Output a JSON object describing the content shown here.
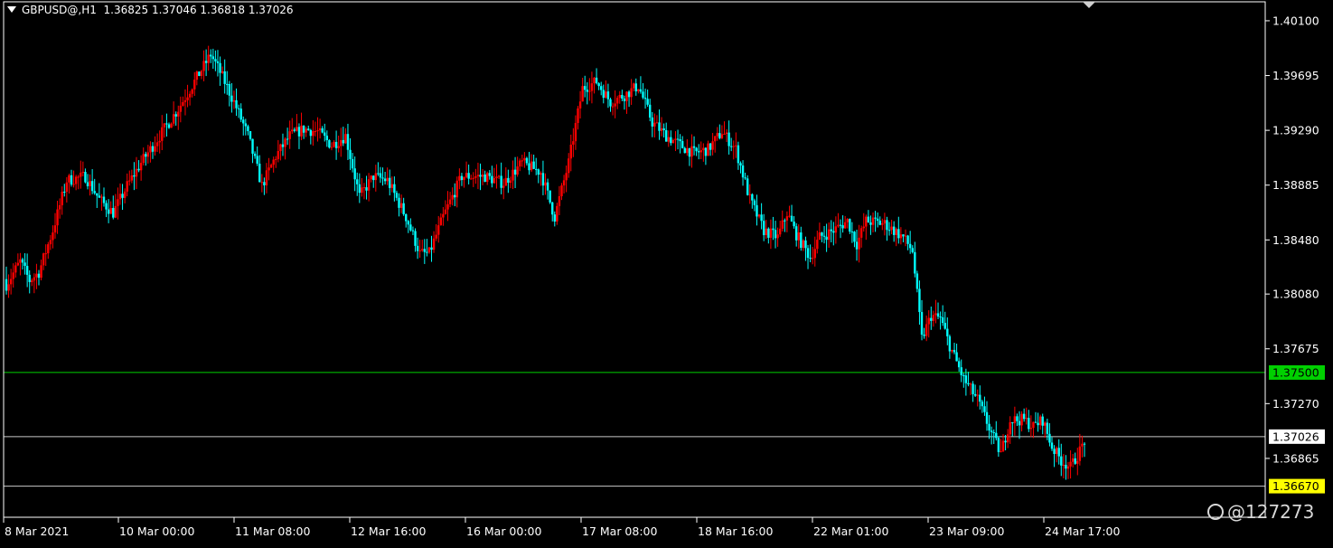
{
  "header": {
    "symbol": "GBPUSD@,H1",
    "ohlc": "1.36825 1.37046 1.36818 1.37026"
  },
  "watermark": {
    "text": "@127273"
  },
  "chart_data": {
    "type": "candlestick",
    "symbol": "GBPUSD@",
    "timeframe": "H1",
    "ylim": [
      1.3643,
      1.4024
    ],
    "colors": {
      "bull": "#ff0000",
      "bear": "#00ffff",
      "background": "#000000",
      "axis": "#ffffff"
    },
    "y_ticks": [
      "1.40100",
      "1.39695",
      "1.39290",
      "1.38885",
      "1.38480",
      "1.38080",
      "1.37675",
      "1.37270",
      "1.36865"
    ],
    "x_ticks": [
      "8 Mar 2021",
      "10 Mar 00:00",
      "11 Mar 08:00",
      "12 Mar 16:00",
      "16 Mar 00:00",
      "17 Mar 08:00",
      "18 Mar 16:00",
      "22 Mar 01:00",
      "23 Mar 09:00",
      "24 Mar 17:00"
    ],
    "horizontal_lines": [
      {
        "price": 1.375,
        "label": "1.37500",
        "color": "#00d000",
        "label_bg": "#00d000",
        "label_color": "#000000"
      },
      {
        "price": 1.37026,
        "label": "1.37026",
        "color": "#c8c8c8",
        "label_bg": "#ffffff",
        "label_color": "#000000"
      },
      {
        "price": 1.3666,
        "label": "1.36670",
        "color": "#c8c8c8",
        "label_bg": "#ffff00",
        "label_color": "#000000"
      }
    ],
    "key_points": [
      [
        0,
        1.3815
      ],
      [
        6,
        1.3832
      ],
      [
        10,
        1.3818
      ],
      [
        14,
        1.3824
      ],
      [
        20,
        1.3855
      ],
      [
        26,
        1.3892
      ],
      [
        34,
        1.3895
      ],
      [
        40,
        1.3878
      ],
      [
        46,
        1.3868
      ],
      [
        52,
        1.3888
      ],
      [
        58,
        1.3905
      ],
      [
        66,
        1.3925
      ],
      [
        74,
        1.3945
      ],
      [
        82,
        1.3968
      ],
      [
        88,
        1.3985
      ],
      [
        92,
        1.3972
      ],
      [
        98,
        1.395
      ],
      [
        104,
        1.3925
      ],
      [
        110,
        1.3888
      ],
      [
        116,
        1.391
      ],
      [
        122,
        1.3925
      ],
      [
        128,
        1.393
      ],
      [
        134,
        1.3928
      ],
      [
        140,
        1.3918
      ],
      [
        146,
        1.3925
      ],
      [
        152,
        1.388
      ],
      [
        158,
        1.3895
      ],
      [
        164,
        1.3892
      ],
      [
        172,
        1.3865
      ],
      [
        178,
        1.3838
      ],
      [
        182,
        1.3838
      ],
      [
        188,
        1.3865
      ],
      [
        196,
        1.3895
      ],
      [
        206,
        1.3895
      ],
      [
        214,
        1.389
      ],
      [
        222,
        1.3905
      ],
      [
        230,
        1.3898
      ],
      [
        236,
        1.3865
      ],
      [
        242,
        1.3905
      ],
      [
        248,
        1.396
      ],
      [
        254,
        1.3965
      ],
      [
        260,
        1.395
      ],
      [
        266,
        1.3955
      ],
      [
        272,
        1.3962
      ],
      [
        278,
        1.3935
      ],
      [
        284,
        1.3925
      ],
      [
        290,
        1.3918
      ],
      [
        296,
        1.3912
      ],
      [
        302,
        1.3915
      ],
      [
        308,
        1.3928
      ],
      [
        314,
        1.3915
      ],
      [
        320,
        1.3878
      ],
      [
        326,
        1.3855
      ],
      [
        332,
        1.385
      ],
      [
        336,
        1.3868
      ],
      [
        340,
        1.3852
      ],
      [
        346,
        1.3835
      ],
      [
        350,
        1.385
      ],
      [
        356,
        1.3855
      ],
      [
        362,
        1.3862
      ],
      [
        366,
        1.3845
      ],
      [
        370,
        1.3862
      ],
      [
        378,
        1.386
      ],
      [
        386,
        1.385
      ],
      [
        390,
        1.384
      ],
      [
        394,
        1.3775
      ],
      [
        398,
        1.3792
      ],
      [
        402,
        1.379
      ],
      [
        406,
        1.377
      ],
      [
        412,
        1.3745
      ],
      [
        418,
        1.373
      ],
      [
        424,
        1.3705
      ],
      [
        428,
        1.369
      ],
      [
        432,
        1.3715
      ],
      [
        438,
        1.3715
      ],
      [
        442,
        1.371
      ],
      [
        446,
        1.3715
      ],
      [
        450,
        1.3695
      ],
      [
        454,
        1.3685
      ],
      [
        458,
        1.368
      ],
      [
        462,
        1.3692
      ],
      [
        464,
        1.37
      ]
    ]
  }
}
